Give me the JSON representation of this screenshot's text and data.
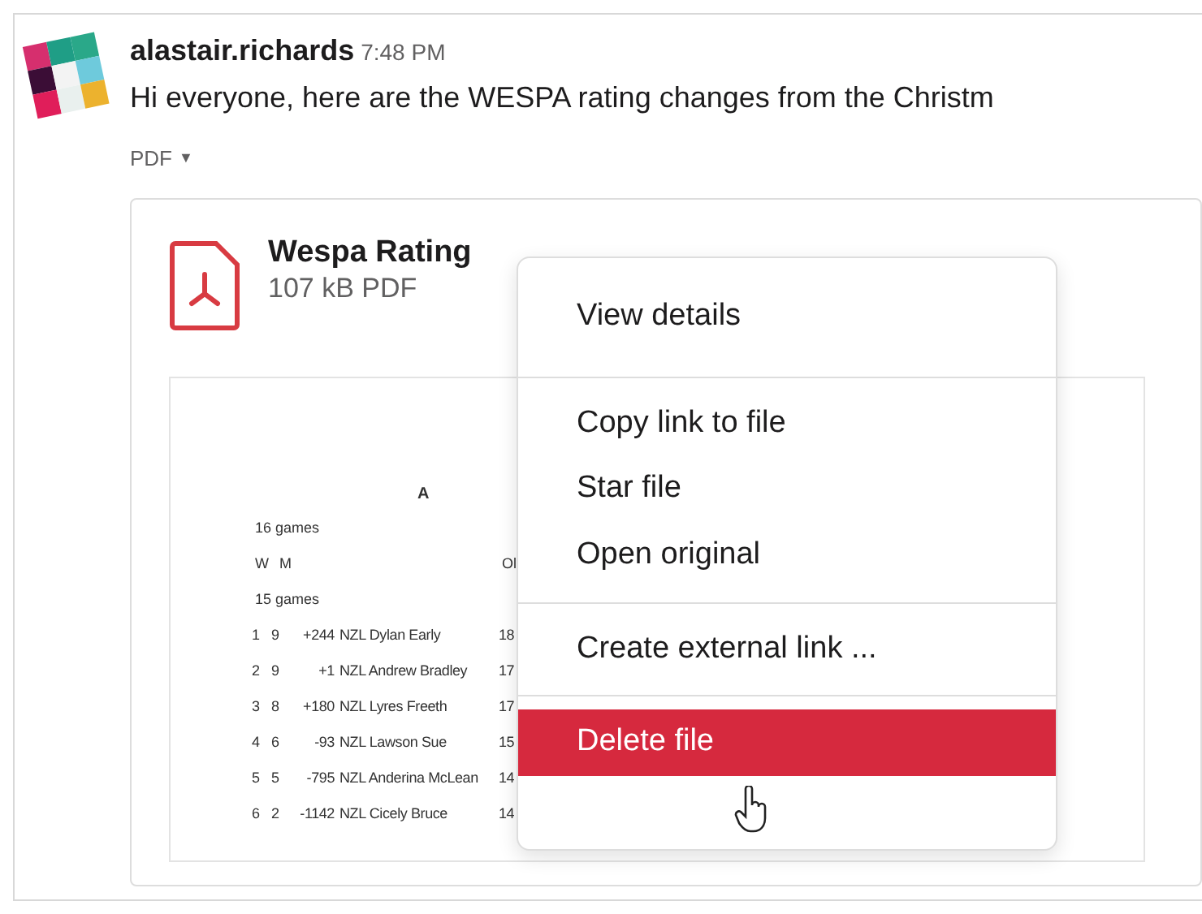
{
  "message": {
    "author": "alastair.richards",
    "time": "7:48 PM",
    "text": "Hi everyone, here are the WESPA rating changes from the Christm",
    "attachment_label": "PDF",
    "attachment_caret": "▼"
  },
  "file": {
    "title": "Wespa Rating",
    "meta": "107 kB PDF"
  },
  "preview": {
    "heading": "A",
    "lines": [
      {
        "kind": "note",
        "text": "16 games"
      },
      {
        "kind": "header",
        "cells": [
          "W",
          "M",
          "Ol"
        ]
      },
      {
        "kind": "note",
        "text": "15 games"
      },
      {
        "kind": "row",
        "cells": [
          "1",
          "9",
          "+244",
          "NZL Dylan Early",
          "18"
        ]
      },
      {
        "kind": "row",
        "cells": [
          "2",
          "9",
          "+1",
          "NZL Andrew Bradley",
          "17"
        ]
      },
      {
        "kind": "row",
        "cells": [
          "3",
          "8",
          "+180",
          "NZL Lyres Freeth",
          "17"
        ]
      },
      {
        "kind": "row",
        "cells": [
          "4",
          "6",
          "-93",
          "NZL Lawson Sue",
          "15"
        ]
      },
      {
        "kind": "row",
        "cells": [
          "5",
          "5",
          "-795",
          "NZL Anderina McLean",
          "14"
        ]
      },
      {
        "kind": "row",
        "cells": [
          "6",
          "2",
          "-1142",
          "NZL Cicely Bruce",
          "14"
        ]
      }
    ]
  },
  "menu": {
    "groups": [
      [
        {
          "label": "View details",
          "selected": false
        }
      ],
      [
        {
          "label": "Copy link to file",
          "selected": false
        },
        {
          "label": "Star file",
          "selected": false
        },
        {
          "label": "Open original",
          "selected": false
        }
      ],
      [
        {
          "label": "Create external link ...",
          "selected": false
        }
      ],
      [
        {
          "label": "Delete file",
          "selected": true
        }
      ]
    ]
  }
}
